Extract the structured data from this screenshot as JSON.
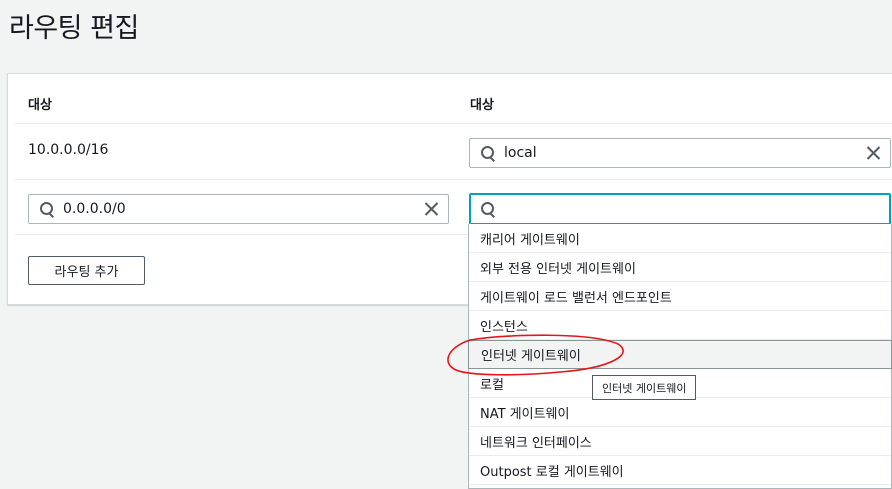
{
  "page": {
    "title": "라우팅 편집"
  },
  "table": {
    "headers": {
      "destination": "대상",
      "target": "대상"
    },
    "rows": [
      {
        "destination": "10.0.0.0/16",
        "target_value": "local"
      },
      {
        "destination_value": "0.0.0.0/0",
        "target_value": ""
      }
    ]
  },
  "actions": {
    "add_route": "라우팅 추가"
  },
  "dropdown": {
    "options": [
      "캐리어 게이트웨이",
      "외부 전용 인터넷 게이트웨이",
      "게이트웨이 로드 밸런서 엔드포인트",
      "인스턴스",
      "인터넷 게이트웨이",
      "로컬",
      "NAT 게이트웨이",
      "네트워크 인터페이스",
      "Outpost 로컬 게이트웨이"
    ],
    "hovered_index": 4,
    "tooltip": "인터넷 게이트웨이"
  },
  "colors": {
    "focus": "#00a1c9",
    "annotation": "#e8141b"
  }
}
